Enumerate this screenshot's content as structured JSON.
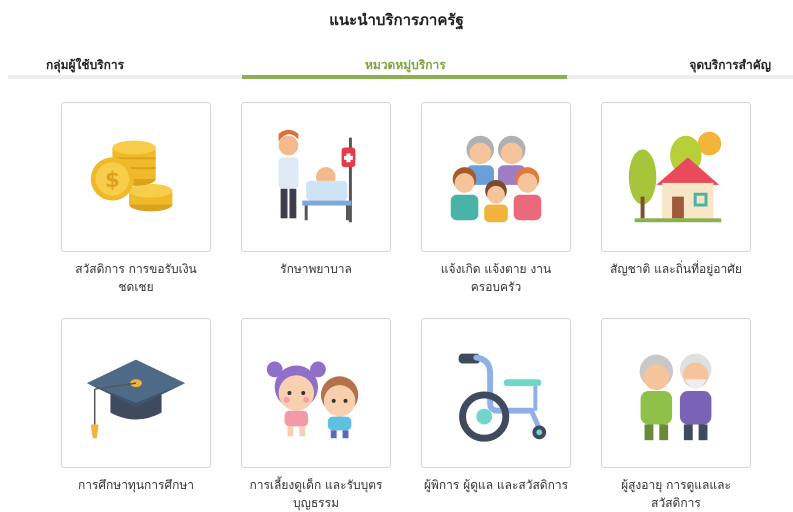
{
  "header": {
    "title": "แนะนำบริการภาครัฐ"
  },
  "tabs": [
    {
      "label": "กลุ่มผู้ใช้บริการ",
      "active": false
    },
    {
      "label": "หมวดหมู่บริการ",
      "active": true
    },
    {
      "label": "จุดบริการสำคัญ",
      "active": false
    }
  ],
  "colors": {
    "accent": "#8bb04f",
    "border": "#d6d6d6"
  },
  "services": [
    {
      "label": "สวัสดิการ การขอรับเงินชดเชย",
      "icon": "coins-icon"
    },
    {
      "label": "รักษาพยาบาล",
      "icon": "hospital-bed-icon"
    },
    {
      "label": "แจ้งเกิด แจ้งตาย งานครอบครัว",
      "icon": "family-icon"
    },
    {
      "label": "สัญชาติ และถิ่นที่อยู่อาศัย",
      "icon": "house-icon"
    },
    {
      "label": "การศึกษาทุนการศึกษา",
      "icon": "graduation-cap-icon"
    },
    {
      "label": "การเลี้ยงดูเด็ก และรับบุตรบุญธรรม",
      "icon": "children-icon"
    },
    {
      "label": "ผู้พิการ ผู้ดูแล และสวัสดิการ",
      "icon": "wheelchair-icon"
    },
    {
      "label": "ผู้สูงอายุ การดูแลและสวัสดิการ",
      "icon": "elderly-icon"
    }
  ]
}
